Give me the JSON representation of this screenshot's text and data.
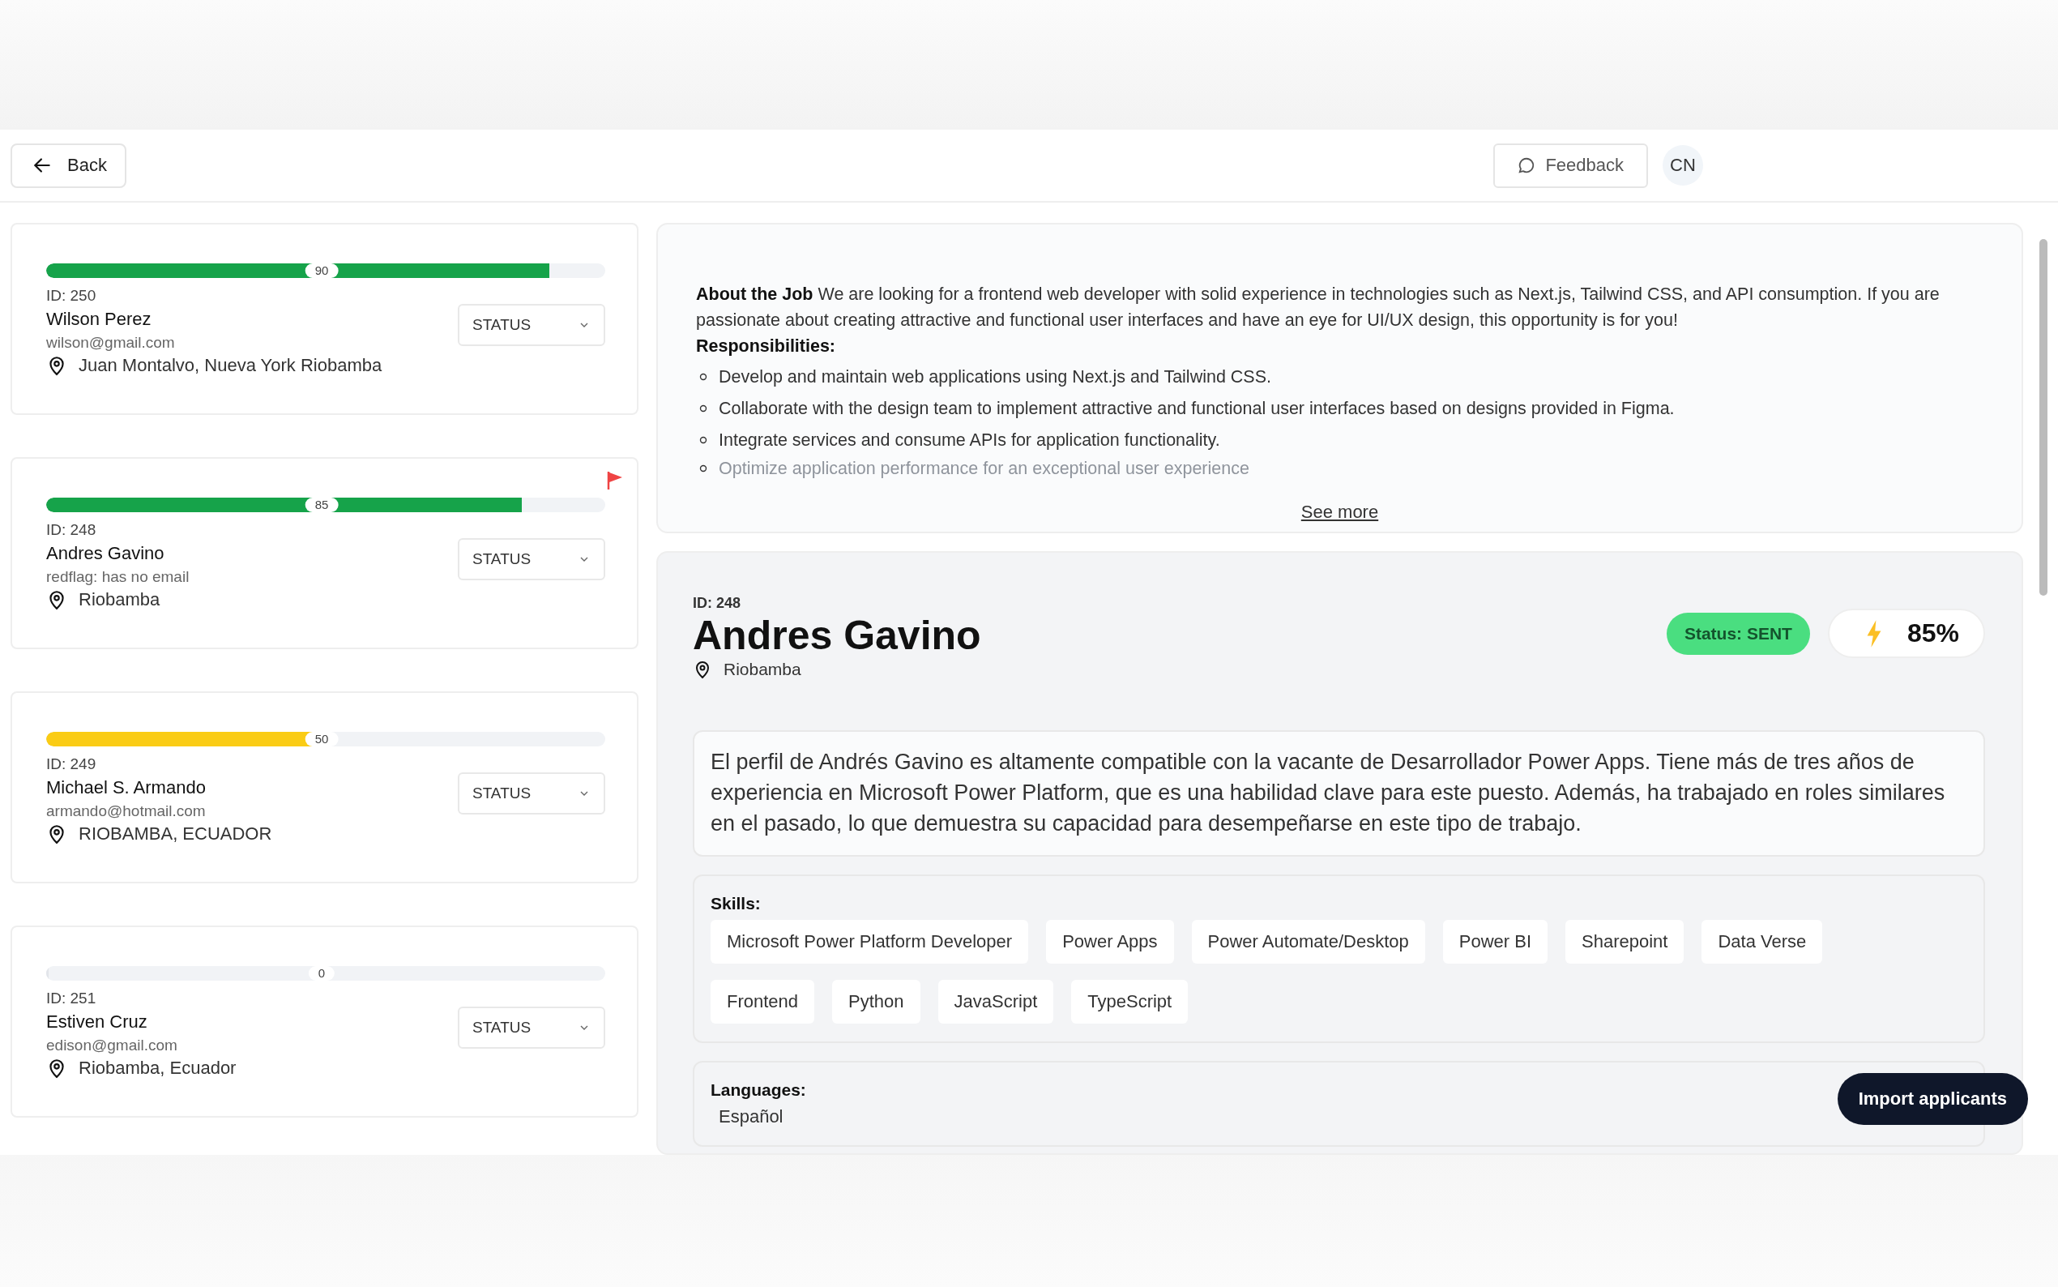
{
  "header": {
    "back": "Back",
    "feedback": "Feedback",
    "avatar": "CN"
  },
  "candidates": [
    {
      "score": "90",
      "level": 0.9,
      "color": "#16a34a",
      "id": "ID: 250",
      "name": "Wilson Perez",
      "email": "wilson@gmail.com",
      "location": "Juan Montalvo, Nueva York Riobamba",
      "status": "STATUS",
      "flagged": false
    },
    {
      "score": "85",
      "level": 0.85,
      "color": "#16a34a",
      "id": "ID: 248",
      "name": "Andres Gavino",
      "email": "redflag: has no email",
      "location": "Riobamba",
      "status": "STATUS",
      "flagged": true
    },
    {
      "score": "50",
      "level": 0.5,
      "color": "#facc15",
      "id": "ID: 249",
      "name": "Michael S. Armando",
      "email": "armando@hotmail.com",
      "location": "RIOBAMBA, ECUADOR",
      "status": "STATUS",
      "flagged": false
    },
    {
      "score": "0",
      "level": 0,
      "id": "ID: 251",
      "name": "Estiven Cruz",
      "email": "edison@gmail.com",
      "location": "Riobamba, Ecuador",
      "status": "STATUS",
      "flagged": false
    }
  ],
  "job": {
    "about_label": "About the Job",
    "about_text": "We are looking for a frontend web developer with solid experience in technologies such as Next.js, Tailwind CSS, and API consumption. If you are passionate about creating attractive and functional user interfaces and have an eye for UI/UX design, this opportunity is for you!",
    "responsibilities_label": "Responsibilities:",
    "responsibilities": [
      "Develop and maintain web applications using Next.js and Tailwind CSS.",
      "Collaborate with the design team to implement attractive and functional user interfaces based on designs provided in Figma.",
      "Integrate services and consume APIs for application functionality.",
      "Optimize application performance for an exceptional user experience"
    ],
    "see_more": "See more"
  },
  "detail": {
    "id": "ID: 248",
    "name": "Andres Gavino",
    "location": "Riobamba",
    "status": "Status: SENT",
    "score": "85%",
    "summary": "El perfil de Andrés Gavino es altamente compatible con la vacante de Desarrollador Power Apps. Tiene más de tres años de experiencia en Microsoft Power Platform, que es una habilidad clave para este puesto. Además, ha trabajado en roles similares en el pasado, lo que demuestra su capacidad para desempeñarse en este tipo de trabajo.",
    "skills_label": "Skills:",
    "skills": [
      "Microsoft Power Platform Developer",
      "Power Apps",
      "Power Automate/Desktop",
      "Power BI",
      "Sharepoint",
      "Data Verse",
      "Frontend",
      "Python",
      "JavaScript",
      "TypeScript"
    ],
    "languages_label": "Languages:",
    "languages": [
      "Español"
    ]
  },
  "import_button": "Import applicants"
}
